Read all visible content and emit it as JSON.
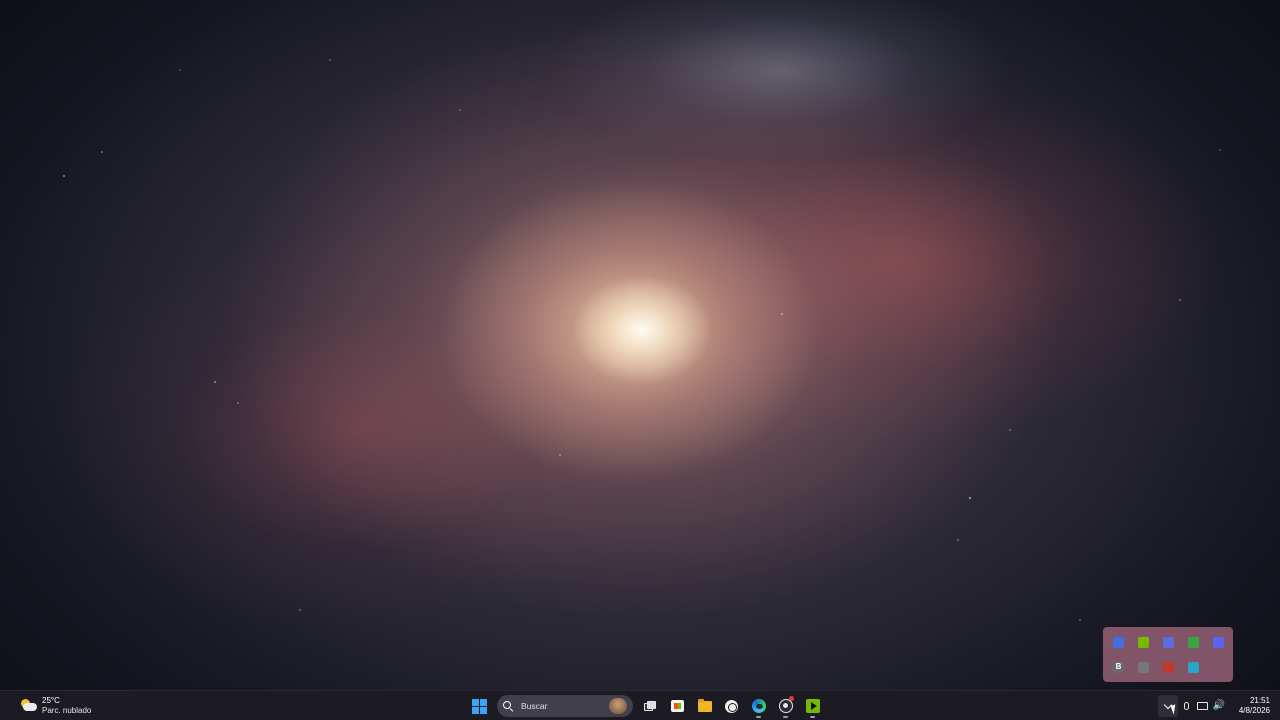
{
  "desktop": {
    "wallpaper": "galaxy"
  },
  "tray_overflow": {
    "icons": [
      {
        "name": "app-blue-icon",
        "label": "",
        "color": "#3f6fe0"
      },
      {
        "name": "nvidia-icon",
        "label": "",
        "color": "#76b900"
      },
      {
        "name": "app-indigo-icon",
        "label": "",
        "color": "#5b6ee1"
      },
      {
        "name": "play-green-icon",
        "label": "",
        "color": "#3aa642"
      },
      {
        "name": "discord-icon",
        "label": "",
        "color": "#5865f2"
      },
      {
        "name": "app-b-icon",
        "label": "B",
        "color": "#6a6a6a"
      },
      {
        "name": "app-square-icon",
        "label": "",
        "color": "#777777"
      },
      {
        "name": "app-colorwheel-icon",
        "label": "",
        "color": "#c0392b"
      },
      {
        "name": "app-cube-icon",
        "label": "",
        "color": "#2aa6c9"
      }
    ]
  },
  "taskbar": {
    "weather": {
      "temp": "25°C",
      "condition": "Parc. nublado"
    },
    "search": {
      "placeholder": "Buscar"
    },
    "clock": {
      "time": "21:51",
      "date": "4/8/2026"
    }
  }
}
